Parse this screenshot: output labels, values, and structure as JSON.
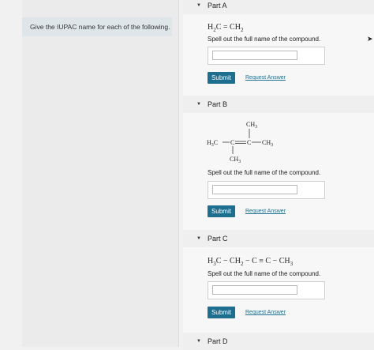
{
  "instructions": "Give the IUPAC name for each of the following.",
  "prompt_text": "Spell out the full name of the compound.",
  "submit_label": "Submit",
  "request_label": "Request Answer",
  "parts": {
    "a": {
      "label": "Part A"
    },
    "b": {
      "label": "Part B",
      "structure": {
        "top": "CH",
        "top_sub": "3",
        "left": "H",
        "left_sub": "3",
        "left_tail": "C",
        "right_tail": "C",
        "right_label": "CH",
        "right_sub": "3",
        "bottom": "CH",
        "bottom_sub": "3",
        "center_left": "C",
        "center_right": "C"
      }
    },
    "c": {
      "label": "Part C"
    },
    "d": {
      "label": "Part D"
    }
  },
  "formula_a": {
    "left": "H",
    "left_sub": "2",
    "left_tail": "C",
    "eq": "=",
    "right": "CH",
    "right_sub": "2"
  },
  "formula_c": {
    "a": "H",
    "a_sub": "3",
    "a_tail": "C",
    "dash1": "−",
    "b": "CH",
    "b_sub": "2",
    "dash2": "−",
    "c": "C",
    "triple": "≡",
    "d": "C",
    "dash3": "−",
    "e": "CH",
    "e_sub": "3"
  },
  "colors": {
    "accent": "#1e6f8f",
    "link": "#1e6f8f"
  }
}
